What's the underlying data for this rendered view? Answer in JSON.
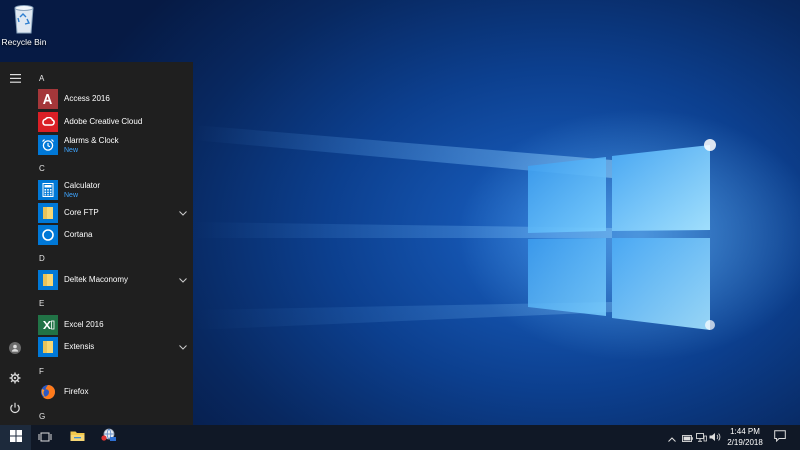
{
  "desktop": {
    "recycle_bin_label": "Recycle Bin"
  },
  "start_menu": {
    "groups": [
      {
        "letter": "A",
        "apps": [
          {
            "name": "Access 2016",
            "sub": "",
            "icon": "access-icon",
            "color": "#a4373a"
          },
          {
            "name": "Adobe Creative Cloud",
            "sub": "",
            "icon": "adobe-cc-icon",
            "color": "#da1f26"
          },
          {
            "name": "Alarms & Clock",
            "sub": "New",
            "icon": "alarm-clock-icon",
            "color": "#0078d7"
          }
        ]
      },
      {
        "letter": "C",
        "apps": [
          {
            "name": "Calculator",
            "sub": "New",
            "icon": "calculator-icon",
            "color": "#0078d7"
          },
          {
            "name": "Core FTP",
            "sub": "",
            "icon": "folder-icon",
            "color": "#0078d7"
          },
          {
            "name": "Cortana",
            "sub": "",
            "icon": "cortana-icon",
            "color": "#0078d7"
          }
        ]
      },
      {
        "letter": "D",
        "apps": [
          {
            "name": "Deltek Maconomy",
            "sub": "",
            "icon": "folder-icon",
            "color": "#0078d7"
          }
        ]
      },
      {
        "letter": "E",
        "apps": [
          {
            "name": "Excel 2016",
            "sub": "",
            "icon": "excel-icon",
            "color": "#217346"
          },
          {
            "name": "Extensis",
            "sub": "",
            "icon": "folder-icon",
            "color": "#0078d7"
          }
        ]
      },
      {
        "letter": "F",
        "apps": [
          {
            "name": "Firefox",
            "sub": "",
            "icon": "firefox-icon",
            "color": "#1f1f1f"
          }
        ]
      },
      {
        "letter": "G",
        "apps": []
      }
    ]
  },
  "taskbar": {
    "time": "1:44 PM",
    "date": "2/19/2018"
  },
  "colors": {
    "accent": "#0078d7",
    "menu_bg": "#1f1f1f",
    "new_badge": "#3ea5ff",
    "taskbar_bg": "#101826"
  }
}
